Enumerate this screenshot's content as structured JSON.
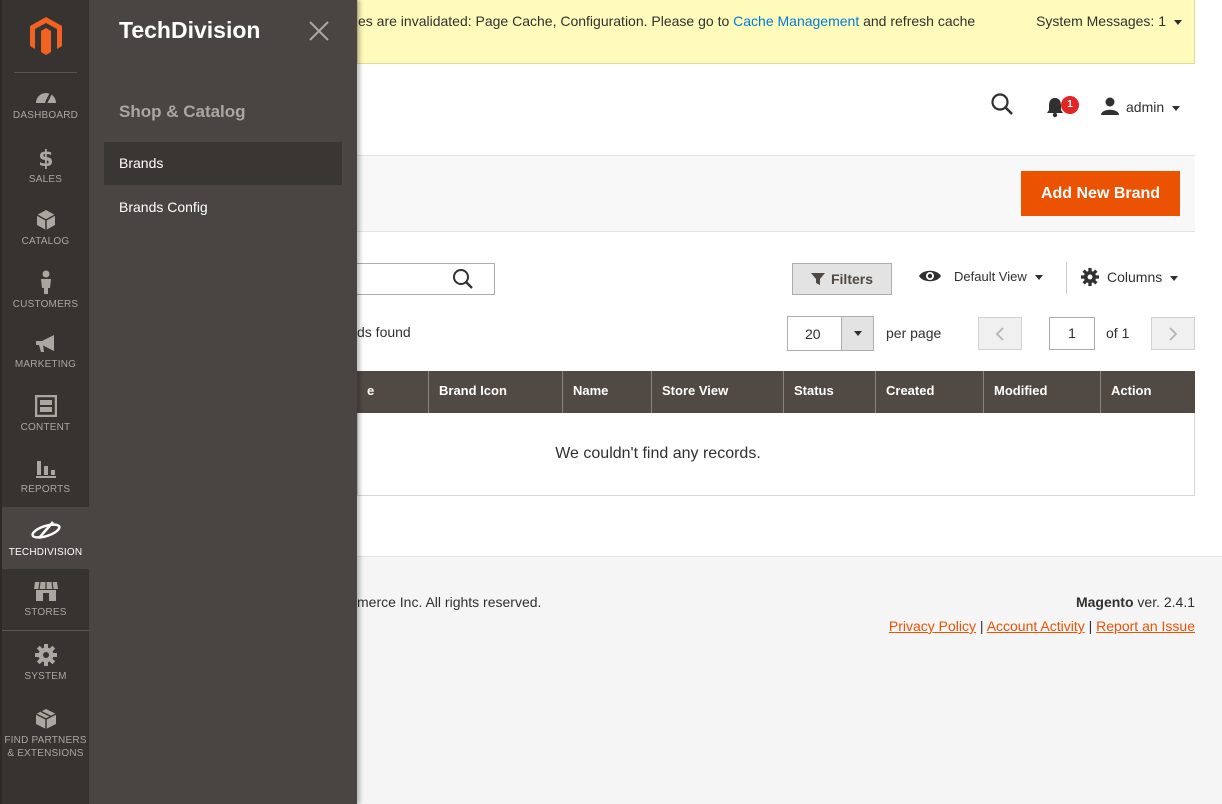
{
  "nav": {
    "items": [
      {
        "label": "DASHBOARD",
        "icon": "speedometer-icon"
      },
      {
        "label": "SALES",
        "icon": "dollar-icon"
      },
      {
        "label": "CATALOG",
        "icon": "cube-icon"
      },
      {
        "label": "CUSTOMERS",
        "icon": "person-icon"
      },
      {
        "label": "MARKETING",
        "icon": "megaphone-icon"
      },
      {
        "label": "CONTENT",
        "icon": "layout-icon"
      },
      {
        "label": "REPORTS",
        "icon": "bar-chart-icon"
      },
      {
        "label": "TECHDIVISION",
        "icon": "techdivision-logo-icon"
      },
      {
        "label": "STORES",
        "icon": "storefront-icon"
      },
      {
        "label": "SYSTEM",
        "icon": "gear-icon"
      },
      {
        "label_line1": "FIND PARTNERS",
        "label_line2": "& EXTENSIONS",
        "icon": "boxes-icon"
      }
    ],
    "active": "TECHDIVISION"
  },
  "flyout": {
    "title": "TechDivision",
    "section": "Shop & Catalog",
    "links": [
      "Brands",
      "Brands Config"
    ],
    "active": "Brands"
  },
  "system_message": {
    "text_before": "es are invalidated: Page Cache, Configuration. Please go to ",
    "link": "Cache Management",
    "text_after": " and refresh cache",
    "count_label": "System Messages: 1"
  },
  "header": {
    "notifications_count": "1",
    "user": "admin"
  },
  "page_actions": {
    "add_button": "Add New Brand"
  },
  "toolbar": {
    "filters": "Filters",
    "view": "Default View",
    "columns": "Columns",
    "records_found": "ds found",
    "per_page_value": "20",
    "per_page_label": "per page",
    "page_value": "1",
    "page_of": "of 1"
  },
  "grid": {
    "columns": [
      "e",
      "Brand Icon",
      "Name",
      "Store View",
      "Status",
      "Created",
      "Modified",
      "Action"
    ],
    "empty": "We couldn't find any records."
  },
  "footer": {
    "copyright": "merce Inc. All rights reserved.",
    "brand": "Magento",
    "version": " ver. 2.4.1",
    "links": [
      "Privacy Policy",
      "Account Activity",
      "Report an Issue"
    ]
  },
  "colors": {
    "accent": "#eb5202",
    "nav_bg": "#373330",
    "flyout_bg": "#4a4542",
    "grid_header": "#514943",
    "link": "#007bdb"
  }
}
